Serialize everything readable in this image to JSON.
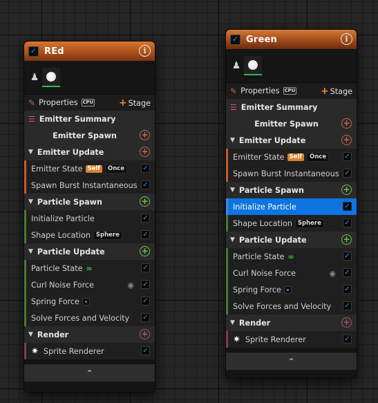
{
  "panels": {
    "red": {
      "title": "REd",
      "properties_label": "Properties",
      "cpu_label": "CPU",
      "stage_label": "Stage",
      "emitter_summary": "Emitter Summary",
      "emitter_spawn": "Emitter Spawn",
      "emitter_update": "Emitter Update",
      "emitter_state": "Emitter State",
      "tag_self": "Self",
      "tag_once": "Once",
      "spawn_burst": "Spawn Burst Instantaneous",
      "particle_spawn": "Particle Spawn",
      "initialize_particle": "Initialize Particle",
      "shape_location": "Shape Location",
      "tag_sphere": "Sphere",
      "particle_update": "Particle Update",
      "particle_state": "Particle State",
      "curl_noise": "Curl Noise Force",
      "spring_force": "Spring Force",
      "solve_forces": "Solve Forces and Velocity",
      "render": "Render",
      "sprite_renderer": "Sprite Renderer"
    },
    "green": {
      "title": "Green",
      "properties_label": "Properties",
      "cpu_label": "CPU",
      "stage_label": "Stage",
      "emitter_summary": "Emitter Summary",
      "emitter_spawn": "Emitter Spawn",
      "emitter_update": "Emitter Update",
      "emitter_state": "Emitter State",
      "tag_self": "Self",
      "tag_once": "Once",
      "spawn_burst": "Spawn Burst Instantaneous",
      "particle_spawn": "Particle Spawn",
      "initialize_particle": "Initialize Particle",
      "shape_location": "Shape Location",
      "tag_sphere": "Sphere",
      "particle_update": "Particle Update",
      "particle_state": "Particle State",
      "curl_noise": "Curl Noise Force",
      "spring_force": "Spring Force",
      "solve_forces": "Solve Forces and Velocity",
      "render": "Render",
      "sprite_renderer": "Sprite Renderer"
    }
  },
  "colors": {
    "title_orange": "#b85a22",
    "selection_blue": "#0d75e0",
    "accent_orange": "#f28a2f",
    "accent_green": "#6fbf4a",
    "check_blue": "#2f8ef0"
  },
  "icons": {
    "info": "info-icon",
    "figure": "person-icon",
    "pencil": "pencil-icon",
    "plus": "plus-icon",
    "list": "list-icon",
    "arrow": "collapse-arrow-icon",
    "eye": "eye-icon",
    "star": "sprite-star-icon",
    "chevron": "chevron-up-icon"
  }
}
